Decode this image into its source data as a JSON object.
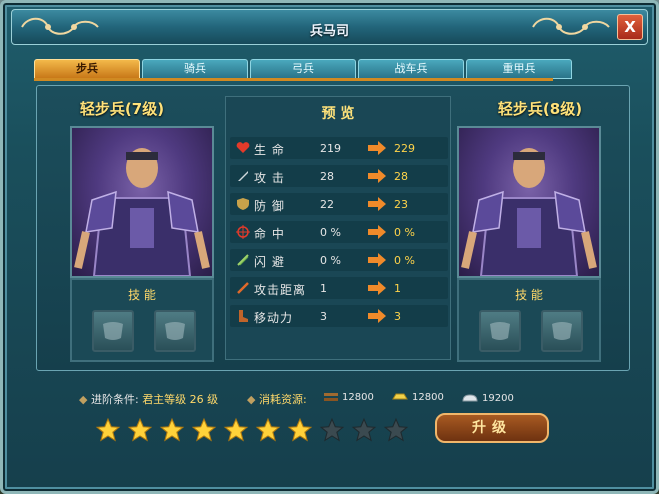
{
  "window": {
    "title": "兵马司",
    "close_label": "X"
  },
  "tabs": [
    {
      "label": "步兵",
      "active": true
    },
    {
      "label": "骑兵",
      "active": false
    },
    {
      "label": "弓兵",
      "active": false
    },
    {
      "label": "战车兵",
      "active": false
    },
    {
      "label": "重甲兵",
      "active": false
    }
  ],
  "left_unit": {
    "name": "轻步兵(7级)",
    "skills_label": "技 能"
  },
  "right_unit": {
    "name": "轻步兵(8级)",
    "skills_label": "技 能"
  },
  "preview": {
    "title": "预 览",
    "stats": [
      {
        "icon": "heart-icon",
        "name": "生 命",
        "old": "219",
        "new": "229"
      },
      {
        "icon": "sword-icon",
        "name": "攻 击",
        "old": "28",
        "new": "28"
      },
      {
        "icon": "shield-icon",
        "name": "防 御",
        "old": "22",
        "new": "23"
      },
      {
        "icon": "crosshair-icon",
        "name": "命 中",
        "old": "0 %",
        "new": "0 %"
      },
      {
        "icon": "dodge-icon",
        "name": "闪 避",
        "old": "0 %",
        "new": "0 %"
      },
      {
        "icon": "range-icon",
        "name": "攻击距离",
        "old": "1",
        "new": "1"
      },
      {
        "icon": "boot-icon",
        "name": "移动力",
        "old": "3",
        "new": "3"
      }
    ]
  },
  "requirements": {
    "condition_label": "进阶条件:",
    "condition_value": "君主等级 26 级",
    "cost_label": "消耗资源:",
    "wood": "12800",
    "gold": "12800",
    "silver": "19200"
  },
  "stars": {
    "filled": 7,
    "total": 10
  },
  "upgrade_button": "升级",
  "colors": {
    "accent": "#ffd44a",
    "tab_active": "#f3b94a",
    "frame": "#1f5d6c"
  }
}
